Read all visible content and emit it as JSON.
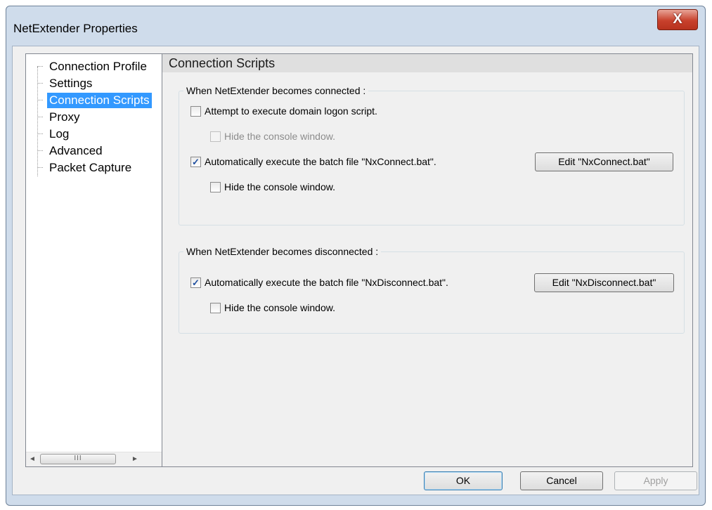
{
  "window": {
    "title": "NetExtender Properties",
    "close_glyph": "X"
  },
  "tree": {
    "items": [
      {
        "label": "Connection Profile"
      },
      {
        "label": "Settings"
      },
      {
        "label": "Connection Scripts",
        "selected": true
      },
      {
        "label": "Proxy"
      },
      {
        "label": "Log"
      },
      {
        "label": "Advanced"
      },
      {
        "label": "Packet Capture"
      }
    ],
    "scroll_left": "◄",
    "scroll_right": "►",
    "scroll_thumb": "III"
  },
  "panel": {
    "title": "Connection Scripts",
    "connected_group": {
      "title": "When NetExtender becomes connected :",
      "logon_script_label": "Attempt to execute domain logon script.",
      "logon_script_checked": false,
      "hide_console_1_label": "Hide the console window.",
      "hide_console_1_checked": false,
      "hide_console_1_disabled": true,
      "batch_label": "Automatically execute the batch file \"NxConnect.bat\".",
      "batch_checked": true,
      "edit_button": "Edit \"NxConnect.bat\"",
      "hide_console_2_label": "Hide the console window.",
      "hide_console_2_checked": false
    },
    "disconnected_group": {
      "title": "When NetExtender becomes disconnected :",
      "batch_label": "Automatically execute the batch file \"NxDisconnect.bat\".",
      "batch_checked": true,
      "edit_button": "Edit \"NxDisconnect.bat\"",
      "hide_console_label": "Hide the console window.",
      "hide_console_checked": false
    }
  },
  "buttons": {
    "ok": "OK",
    "cancel": "Cancel",
    "apply": "Apply"
  },
  "colors": {
    "selection": "#3399ff",
    "close_button": "#c8412c",
    "frame": "#cfdceb"
  },
  "check_glyph": "✓"
}
